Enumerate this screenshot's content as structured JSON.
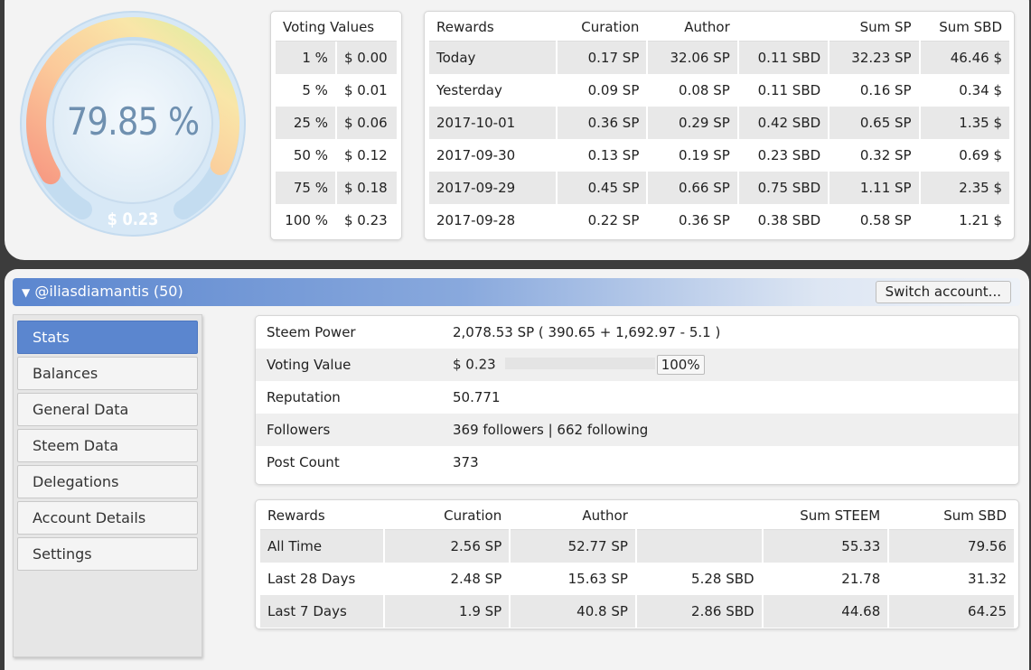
{
  "gauge": {
    "percent_label": "79.85 %",
    "dollar_label": "$ 0.23",
    "fill_fraction": 0.7985
  },
  "voting_values": {
    "header": "Voting Values",
    "rows": [
      {
        "pct": "1 %",
        "value": "$ 0.00"
      },
      {
        "pct": "5 %",
        "value": "$ 0.01"
      },
      {
        "pct": "25 %",
        "value": "$ 0.06"
      },
      {
        "pct": "50 %",
        "value": "$ 0.12"
      },
      {
        "pct": "75 %",
        "value": "$ 0.18"
      },
      {
        "pct": "100 %",
        "value": "$ 0.23"
      }
    ]
  },
  "daily_rewards": {
    "headers": [
      "Rewards",
      "Curation",
      "Author",
      "",
      "Sum SP",
      "Sum SBD"
    ],
    "rows": [
      [
        "Today",
        "0.17 SP",
        "32.06 SP",
        "0.11 SBD",
        "32.23 SP",
        "46.46 $"
      ],
      [
        "Yesterday",
        "0.09 SP",
        "0.08 SP",
        "0.11 SBD",
        "0.16 SP",
        "0.34 $"
      ],
      [
        "2017-10-01",
        "0.36 SP",
        "0.29 SP",
        "0.42 SBD",
        "0.65 SP",
        "1.35 $"
      ],
      [
        "2017-09-30",
        "0.13 SP",
        "0.19 SP",
        "0.23 SBD",
        "0.32 SP",
        "0.69 $"
      ],
      [
        "2017-09-29",
        "0.45 SP",
        "0.66 SP",
        "0.75 SBD",
        "1.11 SP",
        "2.35 $"
      ],
      [
        "2017-09-28",
        "0.22 SP",
        "0.36 SP",
        "0.38 SBD",
        "0.58 SP",
        "1.21 $"
      ]
    ]
  },
  "account": {
    "name": "@iliasdiamantis (50)",
    "switch_label": "Switch account..."
  },
  "sidebar": {
    "items": [
      {
        "label": "Stats",
        "active": true
      },
      {
        "label": "Balances",
        "active": false
      },
      {
        "label": "General Data",
        "active": false
      },
      {
        "label": "Steem Data",
        "active": false
      },
      {
        "label": "Delegations",
        "active": false
      },
      {
        "label": "Account Details",
        "active": false
      },
      {
        "label": "Settings",
        "active": false
      }
    ]
  },
  "stats": {
    "steem_power_label": "Steem Power",
    "steem_power_value": "2,078.53 SP ( 390.65 + 1,692.97 - 5.1 )",
    "voting_value_label": "Voting Value",
    "voting_value_amount": "$ 0.23",
    "voting_value_pct": "100%",
    "voting_value_fraction": 1.0,
    "reputation_label": "Reputation",
    "reputation_value": "50.771",
    "followers_label": "Followers",
    "followers_value": "369 followers | 662 following",
    "post_count_label": "Post Count",
    "post_count_value": "373"
  },
  "total_rewards": {
    "headers": [
      "Rewards",
      "Curation",
      "Author",
      "",
      "Sum STEEM",
      "Sum SBD"
    ],
    "rows": [
      [
        "All Time",
        "2.56 SP",
        "52.77 SP",
        "",
        "55.33",
        "79.56"
      ],
      [
        "Last 28 Days",
        "2.48 SP",
        "15.63 SP",
        "5.28 SBD",
        "21.78",
        "31.32"
      ],
      [
        "Last 7 Days",
        "1.9 SP",
        "40.8 SP",
        "2.86 SBD",
        "44.68",
        "64.25"
      ]
    ]
  },
  "colors": {
    "accent": "#5b86cf",
    "gauge_track": "#c9e2f4",
    "gauge_text": "#6f90b0"
  }
}
